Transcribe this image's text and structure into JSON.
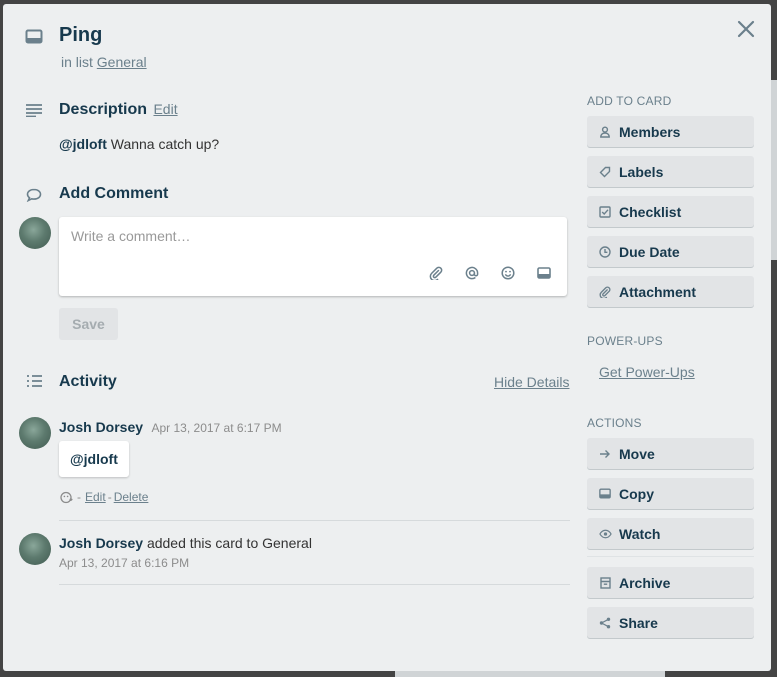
{
  "card": {
    "title": "Ping",
    "in_list_prefix": "in list",
    "list_name": "General"
  },
  "description": {
    "heading": "Description",
    "edit_label": "Edit",
    "mention": "@jdloft",
    "text": "Wanna catch up?"
  },
  "comment": {
    "heading": "Add Comment",
    "placeholder": "Write a comment…",
    "save_label": "Save"
  },
  "activity": {
    "heading": "Activity",
    "hide_details_label": "Hide Details",
    "items": [
      {
        "author": "Josh Dorsey",
        "time": "Apr 13, 2017 at 6:17 PM",
        "comment": "@jdloft",
        "sep": "-",
        "edit_label": "Edit",
        "dash": "-",
        "delete_label": "Delete"
      },
      {
        "author": "Josh Dorsey",
        "action_text": "added this card to General",
        "time": "Apr 13, 2017 at 6:16 PM"
      }
    ]
  },
  "sidebar": {
    "add_to_card_label": "ADD TO CARD",
    "add_to_card": [
      "Members",
      "Labels",
      "Checklist",
      "Due Date",
      "Attachment"
    ],
    "powerups_label": "POWER-UPS",
    "get_powerups_label": "Get Power-Ups",
    "actions_label": "ACTIONS",
    "actions": [
      "Move",
      "Copy",
      "Watch",
      "Archive",
      "Share"
    ]
  },
  "colors": {
    "modal_bg": "#edeff0",
    "text_primary": "#17394d",
    "text_muted": "#6b808c",
    "button_bg": "#e2e4e6"
  }
}
